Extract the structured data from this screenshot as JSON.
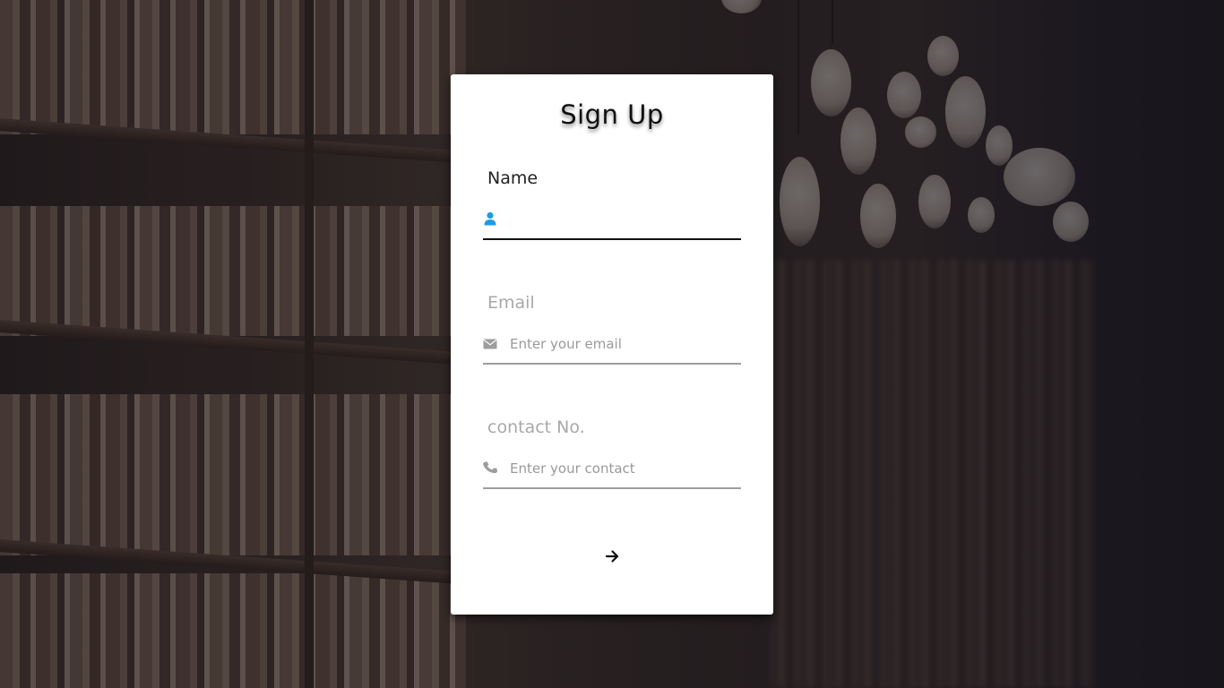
{
  "form": {
    "title": "Sign Up",
    "fields": [
      {
        "label": "Name",
        "icon": "user-icon",
        "value": "",
        "placeholder": ""
      },
      {
        "label": "Email",
        "icon": "envelope-icon",
        "value": "",
        "placeholder": "Enter your email"
      },
      {
        "label": "contact No.",
        "icon": "phone-icon",
        "value": "",
        "placeholder": "Enter your contact"
      }
    ],
    "submit_icon": "arrow-right-icon"
  },
  "colors": {
    "accent": "#1e9be0",
    "icon_muted": "#9e9e9e",
    "card_bg": "#ffffff"
  }
}
